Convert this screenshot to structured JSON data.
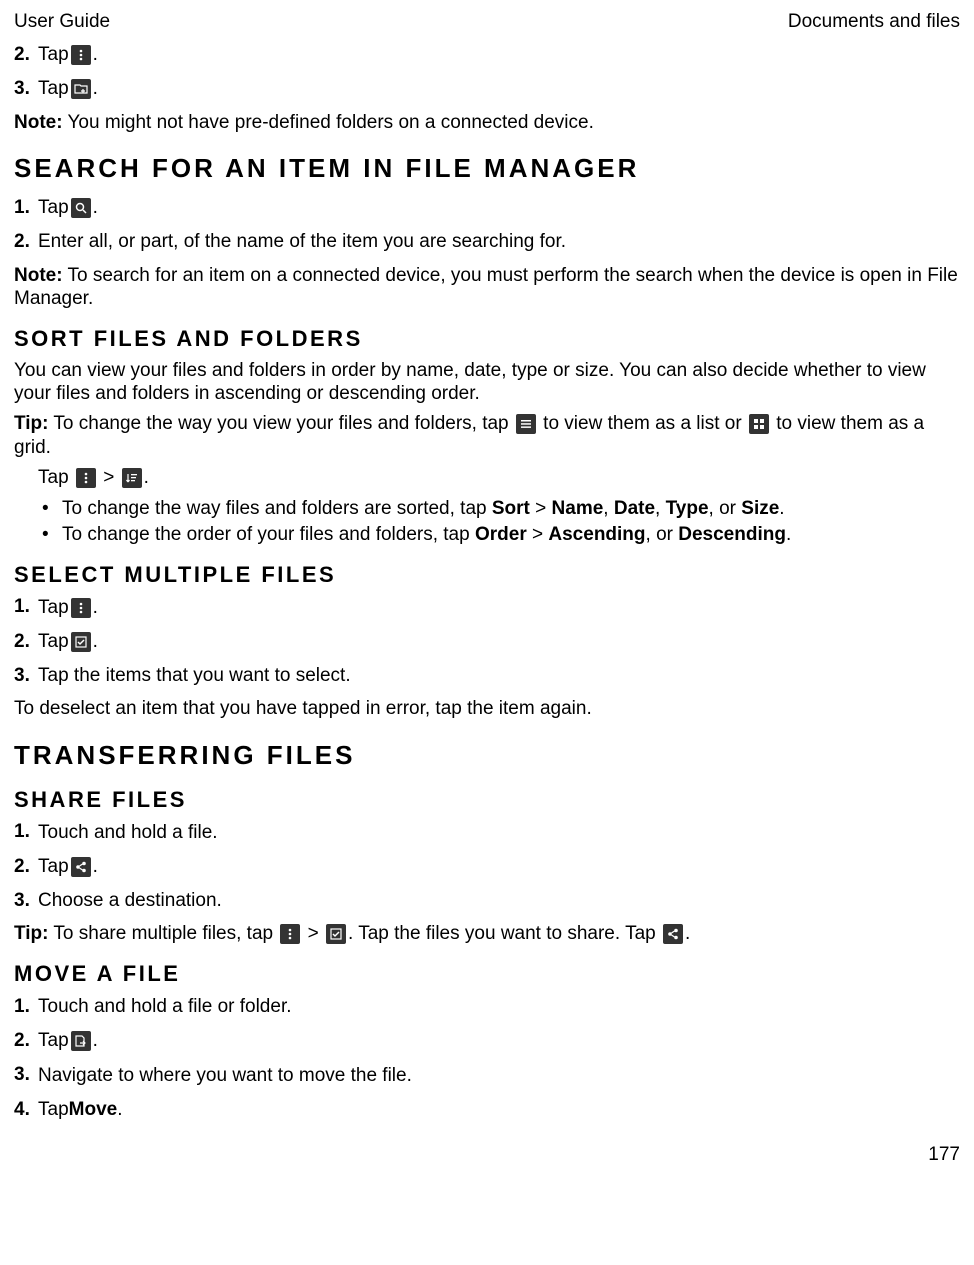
{
  "header": {
    "left": "User Guide",
    "right": "Documents and files"
  },
  "preSteps": {
    "s2": {
      "num": "2.",
      "pre": "Tap ",
      "post": "."
    },
    "s3": {
      "num": "3.",
      "pre": "Tap ",
      "post": "."
    }
  },
  "preNote": {
    "label": "Note:",
    "text": " You might not have pre-defined folders on a connected device."
  },
  "searchHeading": "Search for an item in File Manager",
  "search": {
    "s1": {
      "num": "1.",
      "pre": "Tap ",
      "post": "."
    },
    "s2": {
      "num": "2.",
      "text": "Enter all, or part, of the name of the item you are searching for."
    }
  },
  "searchNote": {
    "label": "Note:",
    "text": " To search for an item on a connected device, you must perform the search when the device is open in File Manager."
  },
  "sortHeading": "Sort files and folders",
  "sortIntro": "You can view your files and folders in order by name, date, type or size. You can also decide whether to view your files and folders in ascending or descending order.",
  "sortTip": {
    "label": "Tip:",
    "t1": " To change the way you view your files and folders, tap ",
    "t2": " to view them as a list or ",
    "t3": " to view them as a grid."
  },
  "sortTapLine": {
    "pre": "Tap ",
    "sep": " > ",
    "post": "."
  },
  "sortBullets": {
    "b1": {
      "t1": "To change the way files and folders are sorted, tap ",
      "sort": "Sort",
      "gt": " > ",
      "name": "Name",
      "c1": ", ",
      "date": "Date",
      "c2": ", ",
      "type": "Type",
      "c3": ", or ",
      "size": "Size",
      "end": "."
    },
    "b2": {
      "t1": "To change the order of your files and folders, tap ",
      "order": "Order",
      "gt": " > ",
      "asc": "Ascending",
      "c1": ", or ",
      "desc": "Descending",
      "end": "."
    }
  },
  "selectHeading": "Select multiple files",
  "select": {
    "s1": {
      "num": "1.",
      "pre": "Tap ",
      "post": "."
    },
    "s2": {
      "num": "2.",
      "pre": "Tap ",
      "post": "."
    },
    "s3": {
      "num": "3.",
      "text": "Tap the items that you want to select."
    }
  },
  "selectOutro": "To deselect an item that you have tapped in error, tap the item again.",
  "transferHeading": "Transferring files",
  "shareHeading": "Share files",
  "share": {
    "s1": {
      "num": "1.",
      "text": "Touch and hold a file."
    },
    "s2": {
      "num": "2.",
      "pre": "Tap ",
      "post": "."
    },
    "s3": {
      "num": "3.",
      "text": "Choose a destination."
    }
  },
  "shareTip": {
    "label": "Tip:",
    "t1": " To share multiple files, tap ",
    "sep": " > ",
    "t2": ". Tap the files you want to share. Tap ",
    "t3": "."
  },
  "moveHeading": "Move a file",
  "move": {
    "s1": {
      "num": "1.",
      "text": "Touch and hold a file or folder."
    },
    "s2": {
      "num": "2.",
      "pre": "Tap ",
      "post": "."
    },
    "s3": {
      "num": "3.",
      "text": "Navigate to where you want to move the file."
    },
    "s4": {
      "num": "4.",
      "pre": "Tap ",
      "bold": "Move",
      "post": "."
    }
  },
  "pageNumber": "177"
}
